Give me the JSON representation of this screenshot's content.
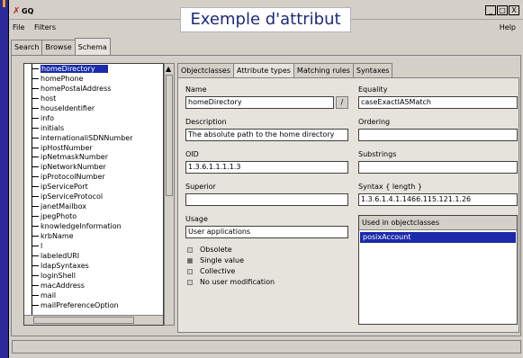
{
  "slide_title": "Exemple d'attribut",
  "window": {
    "title": "GQ",
    "controls": [
      "_",
      "□",
      "X"
    ]
  },
  "menu": {
    "file": "File",
    "filters": "Filters",
    "help": "Help"
  },
  "main_tabs": [
    "Search",
    "Browse",
    "Schema"
  ],
  "tree": {
    "items": [
      "homeDirectory",
      "homePhone",
      "homePostalAddress",
      "host",
      "houseIdentifier",
      "info",
      "initials",
      "internationaliSDNNumber",
      "ipHostNumber",
      "ipNetmaskNumber",
      "ipNetworkNumber",
      "ipProtocolNumber",
      "ipServicePort",
      "ipServiceProtocol",
      "janetMailbox",
      "jpegPhoto",
      "knowledgeInformation",
      "krbName",
      "l",
      "labeledURI",
      "ldapSyntaxes",
      "loginShell",
      "macAddress",
      "mail",
      "mailPreferenceOption"
    ],
    "selected_index": 0
  },
  "detail_tabs": [
    "Objectclasses",
    "Attribute types",
    "Matching rules",
    "Syntaxes"
  ],
  "attribute": {
    "name_label": "Name",
    "name_value": "homeDirectory",
    "description_label": "Description",
    "description_value": "The absolute path to the home directory",
    "oid_label": "OID",
    "oid_value": "1.3.6.1.1.1.1.3",
    "superior_label": "Superior",
    "superior_value": "",
    "usage_label": "Usage",
    "usage_value": "User applications",
    "equality_label": "Equality",
    "equality_value": "caseExactIA5Match",
    "ordering_label": "Ordering",
    "ordering_value": "",
    "substrings_label": "Substrings",
    "substrings_value": "",
    "syntax_label": "Syntax { length }",
    "syntax_value": "1.3.6.1.4.1.1466.115.121.1.26",
    "used_in_label": "Used in objectclasses",
    "used_in": [
      "posixAccount"
    ],
    "checkboxes": [
      {
        "label": "Obsolete",
        "checked": false
      },
      {
        "label": "Single value",
        "checked": true
      },
      {
        "label": "Collective",
        "checked": false
      },
      {
        "label": "No user modification",
        "checked": false
      }
    ]
  }
}
